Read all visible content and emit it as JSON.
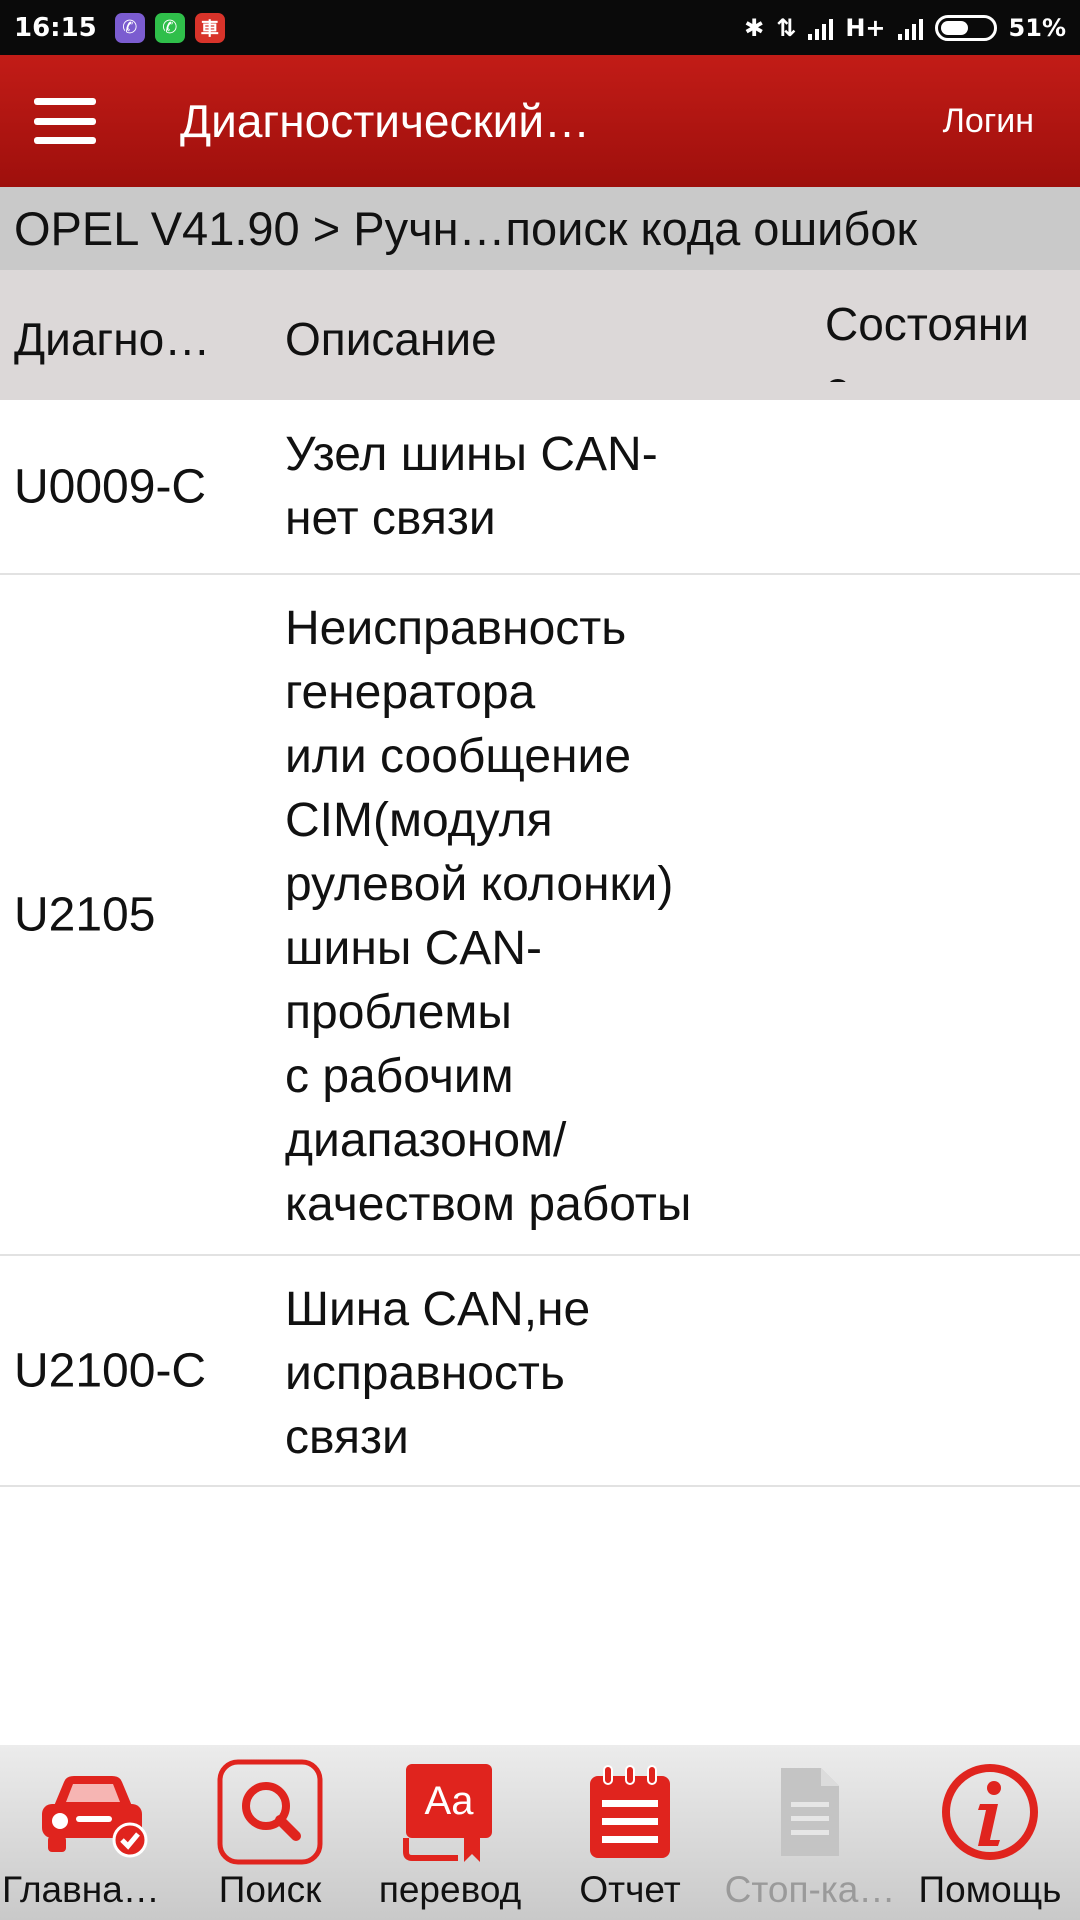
{
  "status_bar": {
    "time": "16:15",
    "network": "H+",
    "battery": "51%"
  },
  "app_bar": {
    "title": "Диагностический…",
    "login_label": "Логин"
  },
  "breadcrumb": "OPEL V41.90 > Ручн…поиск кода ошибок",
  "table": {
    "headers": {
      "code": "Диагно…",
      "description": "Описание",
      "status": "Состояние"
    },
    "rows": [
      {
        "code": "U0009-C",
        "description": "Узел шины CAN-\nнет связи",
        "status": ""
      },
      {
        "code": "U2105",
        "description": "Неисправность\nгенератора\nили сообщение\nCIM(модуля\nрулевой колонки)\nшины CAN-\nпроблемы\nс рабочим\nдиапазоном/\nкачеством работы",
        "status": ""
      },
      {
        "code": "U2100-C",
        "description": "Шина CAN,не\nисправность\nсвязи",
        "status": ""
      }
    ]
  },
  "bottom_nav": {
    "items": [
      {
        "label": "Главная…",
        "icon": "car-check-icon",
        "enabled": true
      },
      {
        "label": "Поиск",
        "icon": "search-icon",
        "enabled": true
      },
      {
        "label": "перевод",
        "icon": "translate-icon",
        "enabled": true
      },
      {
        "label": "Отчет",
        "icon": "report-icon",
        "enabled": true
      },
      {
        "label": "Стоп-ка…",
        "icon": "document-icon",
        "enabled": false
      },
      {
        "label": "Помощь",
        "icon": "info-icon",
        "enabled": true
      }
    ],
    "accent_color": "#e0241e",
    "disabled_color": "#b9b9b9"
  }
}
